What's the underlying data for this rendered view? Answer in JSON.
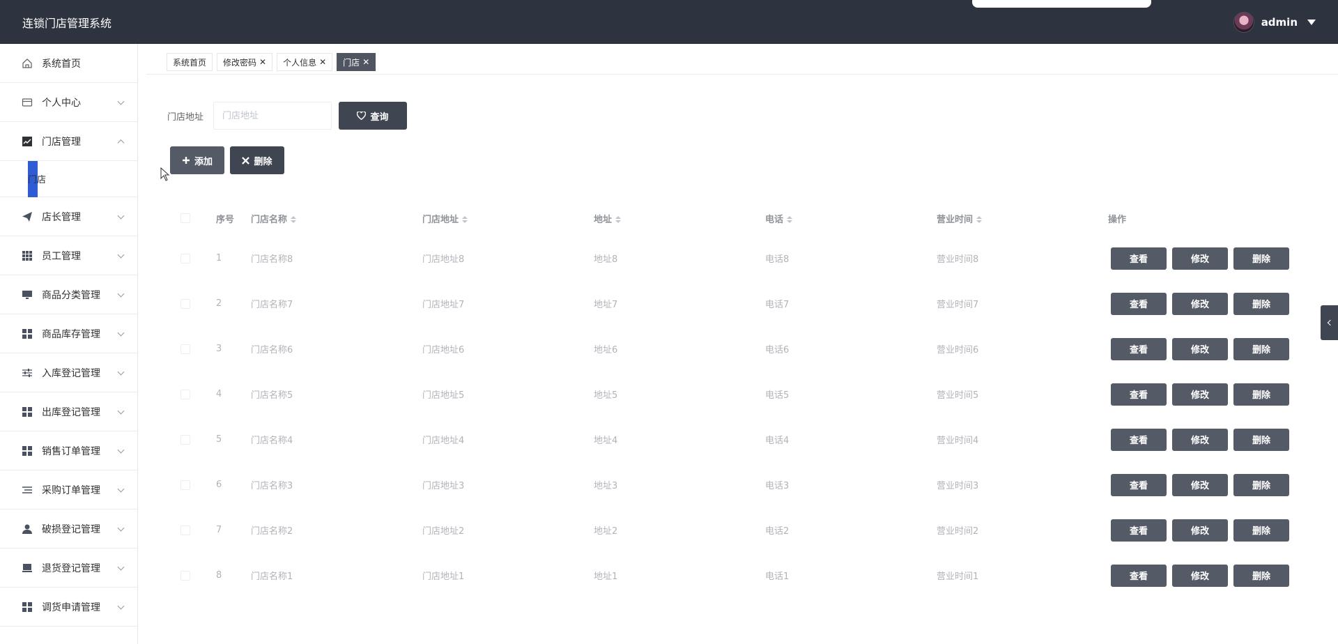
{
  "header": {
    "title": "连锁门店管理系统",
    "user_name": "admin"
  },
  "sidebar": {
    "items": [
      {
        "label": "系统首页",
        "icon": "home-icon",
        "has_arrow": false
      },
      {
        "label": "个人中心",
        "icon": "wallet-icon",
        "has_arrow": true
      },
      {
        "label": "门店管理",
        "icon": "chart-icon",
        "has_arrow": true,
        "expanded": true
      },
      {
        "label": "店长管理",
        "icon": "send-icon",
        "has_arrow": true
      },
      {
        "label": "员工管理",
        "icon": "grid-icon",
        "has_arrow": true
      },
      {
        "label": "商品分类管理",
        "icon": "monitor-icon",
        "has_arrow": true
      },
      {
        "label": "商品库存管理",
        "icon": "apps-icon",
        "has_arrow": true
      },
      {
        "label": "入库登记管理",
        "icon": "sliders-icon",
        "has_arrow": true
      },
      {
        "label": "出库登记管理",
        "icon": "apps-icon",
        "has_arrow": true
      },
      {
        "label": "销售订单管理",
        "icon": "apps-icon",
        "has_arrow": true
      },
      {
        "label": "采购订单管理",
        "icon": "list-icon",
        "has_arrow": true
      },
      {
        "label": "破损登记管理",
        "icon": "user-icon",
        "has_arrow": true
      },
      {
        "label": "退货登记管理",
        "icon": "tray-icon",
        "has_arrow": true
      },
      {
        "label": "调货申请管理",
        "icon": "apps-icon",
        "has_arrow": true
      }
    ],
    "submenu": {
      "label": "门店"
    }
  },
  "tabs": [
    {
      "label": "系统首页",
      "closable": false,
      "active": false
    },
    {
      "label": "修改密码",
      "closable": true,
      "active": false
    },
    {
      "label": "个人信息",
      "closable": true,
      "active": false
    },
    {
      "label": "门店",
      "closable": true,
      "active": true
    }
  ],
  "search": {
    "label": "门店地址",
    "placeholder": "门店地址",
    "value": "",
    "query_label": "查询"
  },
  "actions": {
    "add_label": "添加",
    "delete_label": "删除"
  },
  "table": {
    "columns": [
      "序号",
      "门店名称",
      "门店地址",
      "地址",
      "电话",
      "营业时间",
      "操作"
    ],
    "op_labels": {
      "view": "查看",
      "edit": "修改",
      "delete": "删除"
    },
    "rows": [
      {
        "idx": "1",
        "name": "门店名称8",
        "addr": "门店地址8",
        "loc": "地址8",
        "tel": "电话8",
        "hours": "营业时间8"
      },
      {
        "idx": "2",
        "name": "门店名称7",
        "addr": "门店地址7",
        "loc": "地址7",
        "tel": "电话7",
        "hours": "营业时间7"
      },
      {
        "idx": "3",
        "name": "门店名称6",
        "addr": "门店地址6",
        "loc": "地址6",
        "tel": "电话6",
        "hours": "营业时间6"
      },
      {
        "idx": "4",
        "name": "门店名称5",
        "addr": "门店地址5",
        "loc": "地址5",
        "tel": "电话5",
        "hours": "营业时间5"
      },
      {
        "idx": "5",
        "name": "门店名称4",
        "addr": "门店地址4",
        "loc": "地址4",
        "tel": "电话4",
        "hours": "营业时间4"
      },
      {
        "idx": "6",
        "name": "门店名称3",
        "addr": "门店地址3",
        "loc": "地址3",
        "tel": "电话3",
        "hours": "营业时间3"
      },
      {
        "idx": "7",
        "name": "门店名称2",
        "addr": "门店地址2",
        "loc": "地址2",
        "tel": "电话2",
        "hours": "营业时间2"
      },
      {
        "idx": "8",
        "name": "门店名称1",
        "addr": "门店地址1",
        "loc": "地址1",
        "tel": "电话1",
        "hours": "营业时间1"
      }
    ]
  },
  "colors": {
    "header_bg": "#2d3440",
    "button_dark": "#3f4651",
    "button_gray": "#545b66",
    "active_submenu": "#2f5bd4"
  }
}
